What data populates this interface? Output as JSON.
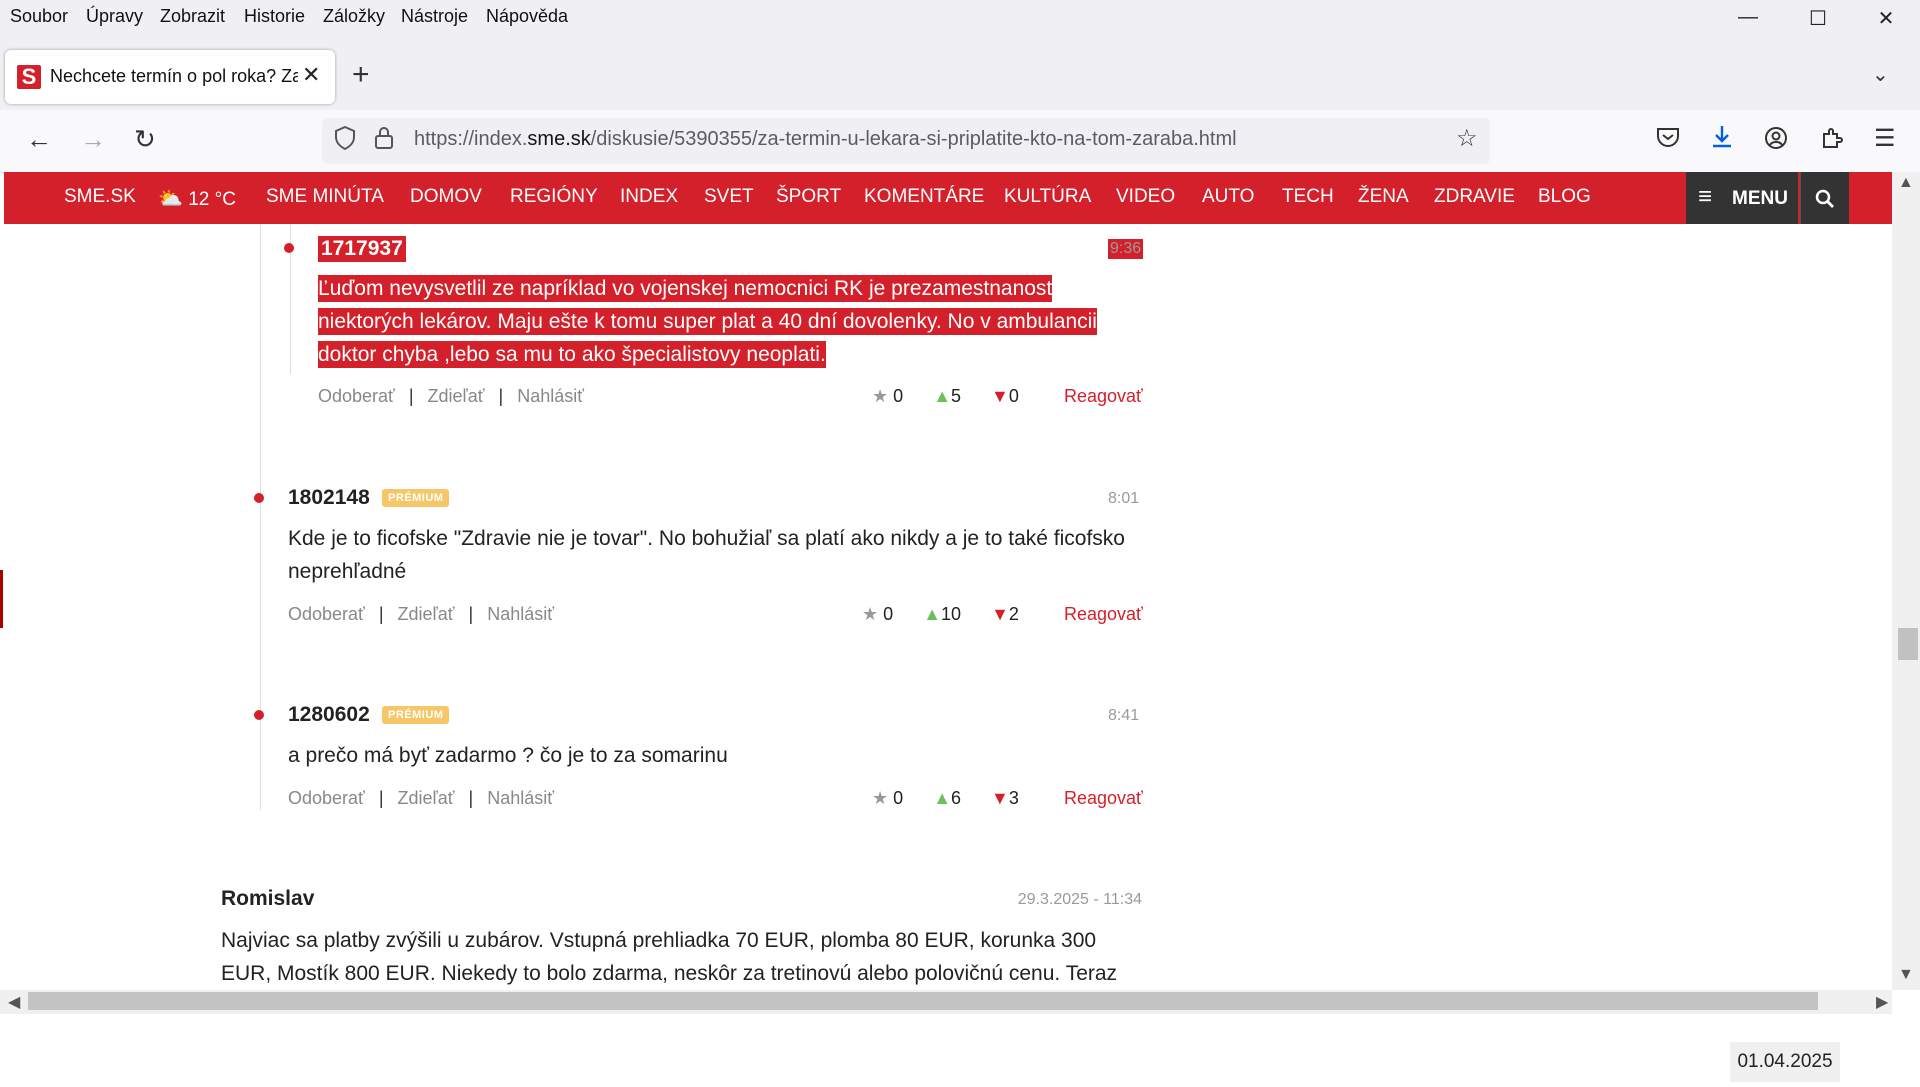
{
  "window": {
    "menu": [
      "Soubor",
      "Úpravy",
      "Zobrazit",
      "Historie",
      "Záložky",
      "Nástroje",
      "Nápověda"
    ],
    "controls": {
      "minimize": "—",
      "maximize": "☐",
      "close": "✕"
    }
  },
  "tab": {
    "favicon": "S",
    "title": "Nechcete termín o pol roka? Za",
    "close": "✕",
    "new_tab": "+",
    "list_all": "⌄"
  },
  "urlbar": {
    "prefix": "https://index.",
    "domain": "sme.sk",
    "path": "/diskusie/5390355/za-termin-u-lekara-si-priplatite-kto-na-tom-zaraba.html"
  },
  "sitenav": {
    "items": [
      "SME.SK",
      "12 °C",
      "SME MINÚTA",
      "DOMOV",
      "REGIÓNY",
      "INDEX",
      "SVET",
      "ŠPORT",
      "KOMENTÁRE",
      "KULTÚRA",
      "VIDEO",
      "AUTO",
      "TECH",
      "ŽENA",
      "ZDRAVIE",
      "BLOG"
    ],
    "menu_label": "MENU"
  },
  "comments": [
    {
      "author": "1717937",
      "premium": false,
      "time": "9:36",
      "text": "Ľuďom nevysvetlil ze napríklad vo vojenskej nemocnici RK je prezamestnanost niektorých lekárov. Maju ešte k tomu super plat a 40 dní dovolenky. No v ambulancii doktor chyba ,lebo sa mu to ako špecialistovy neoplati.",
      "stars": "0",
      "up": "5",
      "down": "0"
    },
    {
      "author": "1802148",
      "premium": true,
      "time": "8:01",
      "text": "Kde je to ficofske \"Zdravie nie je tovar\". No bohužiaľ sa platí ako nikdy a je to také ficofsko neprehľadné",
      "stars": "0",
      "up": "10",
      "down": "2"
    },
    {
      "author": "1280602",
      "premium": true,
      "time": "8:41",
      "text": "a prečo má byť zadarmo ? čo je to za somarinu",
      "stars": "0",
      "up": "6",
      "down": "3"
    },
    {
      "author": "Romislav",
      "premium": false,
      "time": "29.3.2025 - 11:34",
      "text": "Najviac sa platby zvýšili u zubárov. Vstupná prehliadka 70 EUR, plomba 80 EUR, korunka 300 EUR, Mostík 800 EUR. Niekedy to bolo zdarma, neskôr za tretinovú alebo polovičnú cenu. Teraz"
    }
  ],
  "labels": {
    "subscribe": "Odoberať",
    "share": "Zdieľať",
    "report": "Nahlásiť",
    "reply": "Reagovať",
    "premium": "PRÉMIUM",
    "sep": "|"
  },
  "taskbar": {
    "date": "01.04.2025"
  },
  "colors": {
    "brand": "#d4202a",
    "premium_badge": "#f6c667",
    "upvote": "#6cc05c"
  }
}
